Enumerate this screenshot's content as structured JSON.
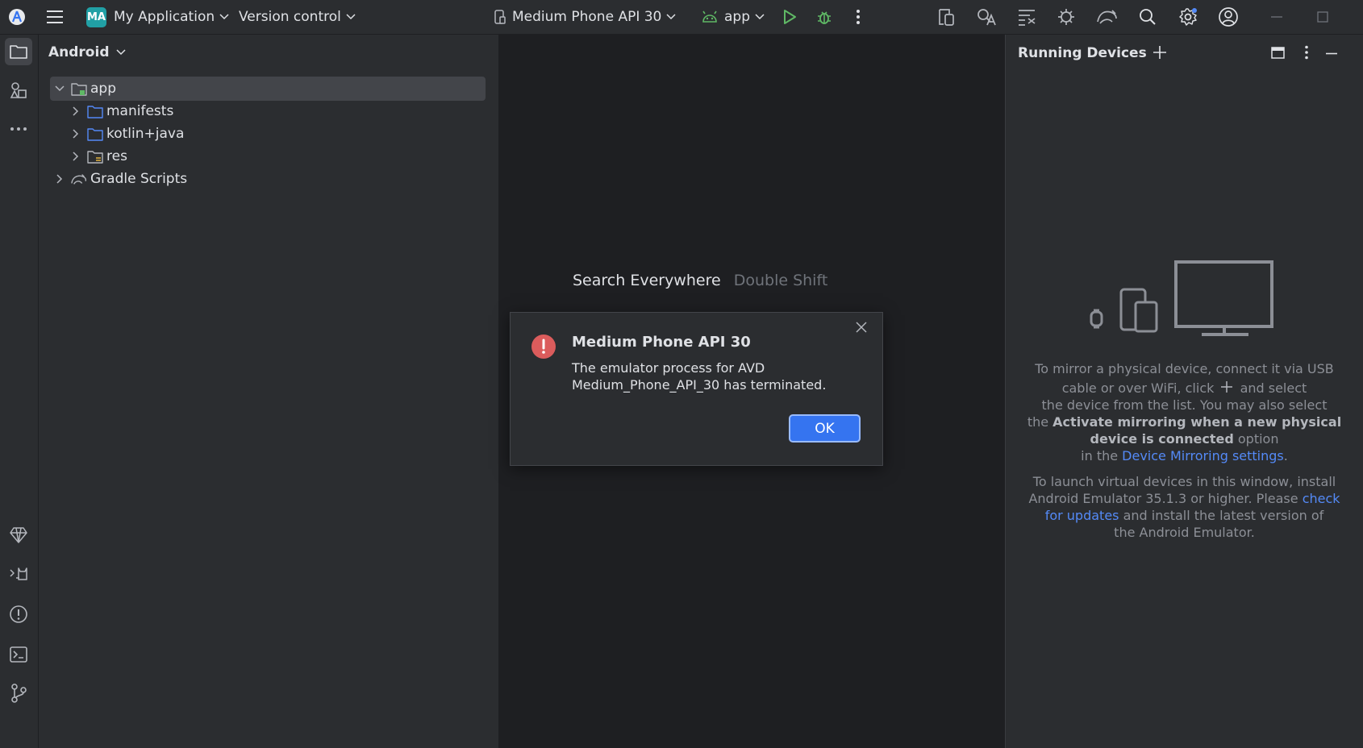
{
  "titlebar": {
    "project_badge": "MA",
    "project_name": "My Application",
    "vcs": "Version control",
    "device": "Medium Phone API 30",
    "run_config": "app"
  },
  "project_panel": {
    "view": "Android",
    "tree": [
      {
        "label": "app",
        "level": 0,
        "expanded": true,
        "selected": true
      },
      {
        "label": "manifests",
        "level": 1
      },
      {
        "label": "kotlin+java",
        "level": 1
      },
      {
        "label": "res",
        "level": 1
      },
      {
        "label": "Gradle Scripts",
        "level": 0
      }
    ]
  },
  "editor": {
    "hint_label": "Search Everywhere",
    "hint_shortcut": "Double Shift"
  },
  "running_devices": {
    "title": "Running Devices",
    "p1_a": "To mirror a physical device, connect it via USB",
    "p1_b": "cable or over WiFi, click",
    "p1_c": "and select",
    "p1_d": "the device from the list. You may also select",
    "p1_e": "the",
    "p1_bold1": "Activate mirroring when a new physical",
    "p1_bold2": "device is connected",
    "p1_f": "option",
    "p1_g": "in the",
    "p1_link": "Device Mirroring settings",
    "p1_h": ".",
    "p2_a": "To launch virtual devices in this window, install",
    "p2_b": "Android Emulator 35.1.3 or higher. Please",
    "p2_link1": "check",
    "p2_link2": "for updates",
    "p2_c": "and install the latest version of",
    "p2_d": "the Android Emulator."
  },
  "dialog": {
    "title": "Medium Phone API 30",
    "message_line1": "The emulator process for AVD",
    "message_line2": "Medium_Phone_API_30 has terminated.",
    "ok_label": "OK"
  },
  "colors": {
    "accent": "#3574f0",
    "error": "#db5c5c",
    "run_green": "#5fb865",
    "link": "#548af7",
    "badge": "#21a0a5"
  }
}
